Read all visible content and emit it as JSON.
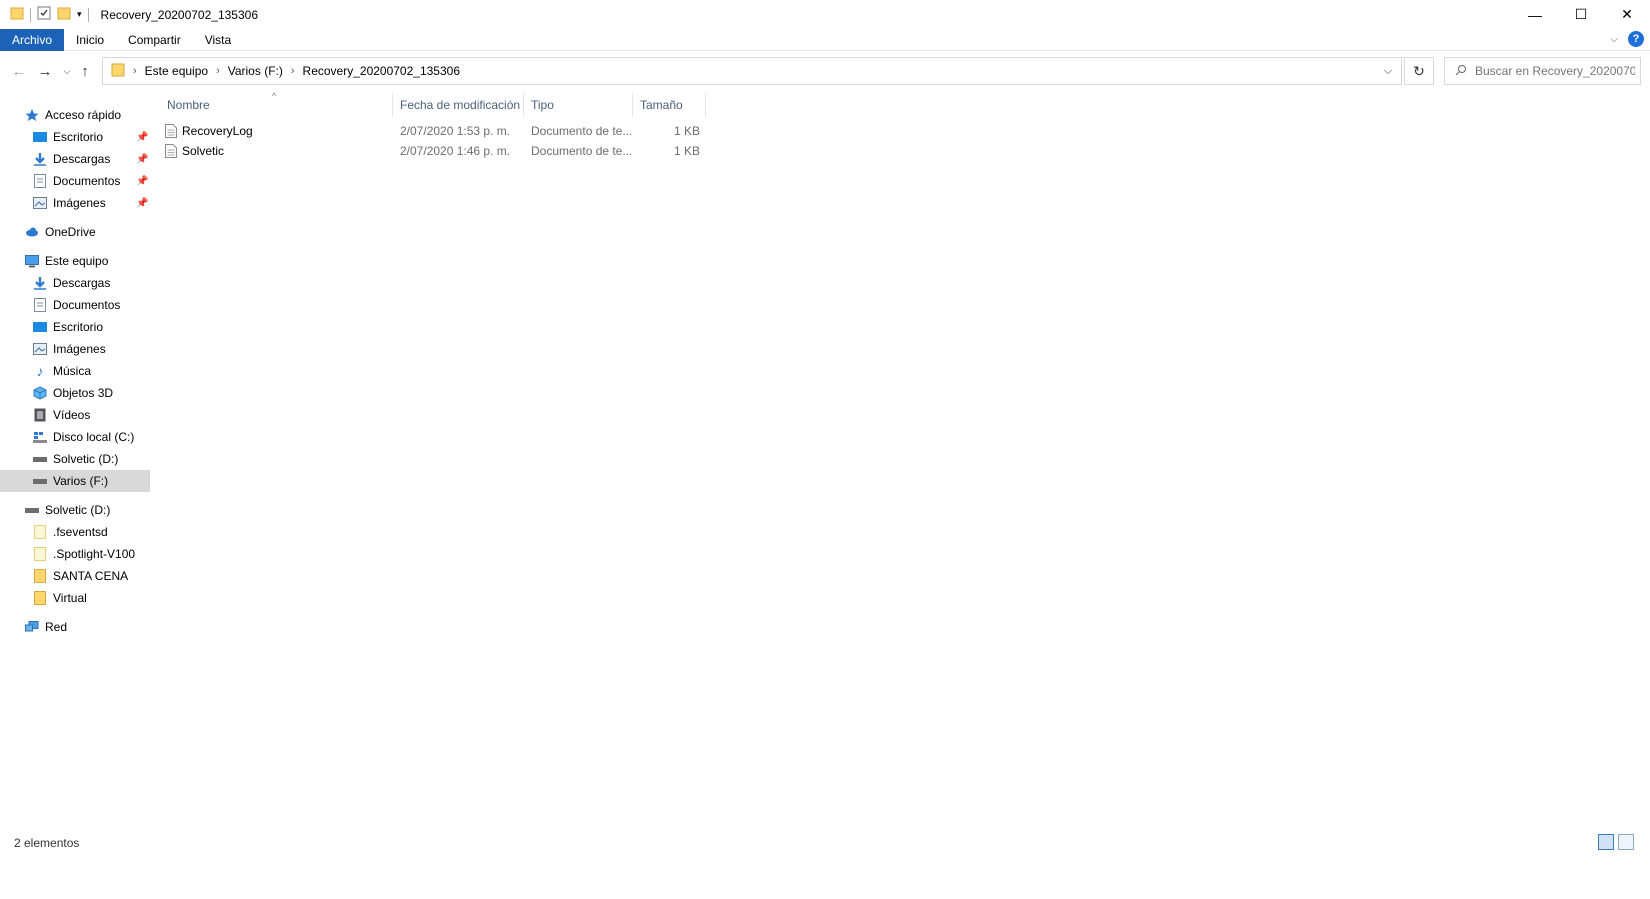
{
  "window": {
    "title": "Recovery_20200702_135306",
    "controls": {
      "minimize": "—",
      "maximize": "☐",
      "close": "✕"
    }
  },
  "ribbon": {
    "tabs": [
      "Archivo",
      "Inicio",
      "Compartir",
      "Vista"
    ],
    "help_label": "?"
  },
  "address": {
    "crumbs": [
      "Este equipo",
      "Varios (F:)",
      "Recovery_20200702_135306"
    ],
    "search_placeholder": "Buscar en Recovery_2020070..."
  },
  "nav": {
    "quick_access": "Acceso rápido",
    "quick_items": [
      "Escritorio",
      "Descargas",
      "Documentos",
      "Imágenes"
    ],
    "onedrive": "OneDrive",
    "this_pc": "Este equipo",
    "pc_items": [
      "Descargas",
      "Documentos",
      "Escritorio",
      "Imágenes",
      "Música",
      "Objetos 3D",
      "Vídeos",
      "Disco local (C:)",
      "Solvetic (D:)",
      "Varios (F:)"
    ],
    "drive": "Solvetic (D:)",
    "drive_items": [
      ".fseventsd",
      ".Spotlight-V100",
      "SANTA CENA",
      "Virtual"
    ],
    "network": "Red"
  },
  "columns": [
    "Nombre",
    "Fecha de modificación",
    "Tipo",
    "Tamaño"
  ],
  "files": [
    {
      "name": "RecoveryLog",
      "date": "2/07/2020 1:53 p. m.",
      "type": "Documento de te...",
      "size": "1 KB"
    },
    {
      "name": "Solvetic",
      "date": "2/07/2020 1:46 p. m.",
      "type": "Documento de te...",
      "size": "1 KB"
    }
  ],
  "status": {
    "count": "2 elementos"
  },
  "colors": {
    "accent": "#1c62b9",
    "selected": "#d9d9d9",
    "folder": "#ffd66b"
  }
}
